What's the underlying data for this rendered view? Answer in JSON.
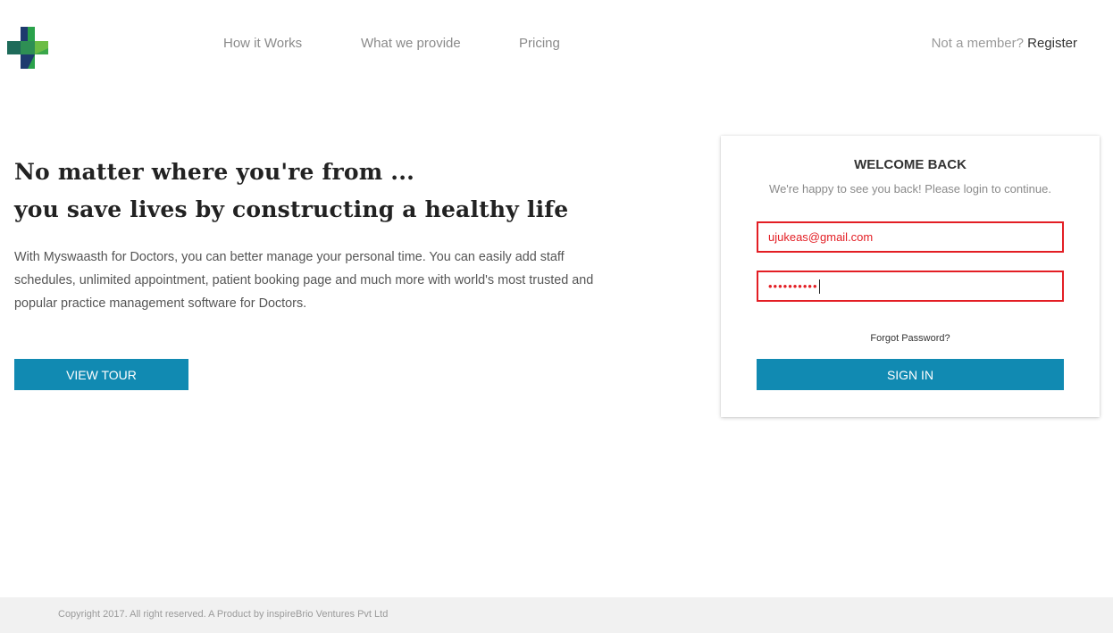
{
  "header": {
    "logo_icon": "medical-cross-logo-icon",
    "nav": [
      {
        "label": "How it Works"
      },
      {
        "label": "What we provide"
      },
      {
        "label": "Pricing"
      }
    ],
    "member_prompt": "Not a member?",
    "register_label": "Register"
  },
  "hero": {
    "title_line1": "No matter where you're from ...",
    "title_line2": "you save lives by constructing a healthy life",
    "description": "With Myswaasth for Doctors, you can better manage your personal time. You can easily add staff schedules, unlimited appointment, patient booking page and much more with world's most trusted and popular practice management software for Doctors.",
    "tour_button": "VIEW TOUR"
  },
  "login": {
    "title": "WELCOME BACK",
    "subtitle": "We're happy to see you back! Please login to continue.",
    "email_value": "ujukeas@gmail.com",
    "password_mask": "••••••••••",
    "forgot_label": "Forgot Password?",
    "signin_button": "SIGN IN"
  },
  "footer": {
    "copyright": "Copyright 2017. All right reserved. A Product by inspireBrio Ventures Pvt Ltd"
  },
  "colors": {
    "accent": "#118ab2",
    "error": "#e31e24",
    "logo_green": "#3aa64a",
    "logo_navy": "#1e3b6e"
  }
}
